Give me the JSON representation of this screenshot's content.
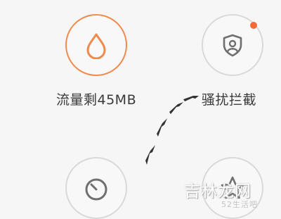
{
  "tiles": {
    "traffic": {
      "label": "流量剩45MB",
      "icon": "water-drop-icon"
    },
    "block": {
      "label": "骚扰拦截",
      "icon": "shield-user-icon",
      "has_badge": true
    },
    "timer": {
      "icon": "timer-icon"
    },
    "star": {
      "icon": "star-icon"
    }
  },
  "annotation": {
    "icon": "arrow-path-icon"
  },
  "watermark": {
    "text": "吉林龙网",
    "subtext": "52生活吧"
  },
  "colors": {
    "accent_orange": "#f08a4b",
    "badge": "#f26a3a",
    "icon_gray": "#6f6f6f",
    "text": "#3a3a3a",
    "arrow": "#333333"
  }
}
